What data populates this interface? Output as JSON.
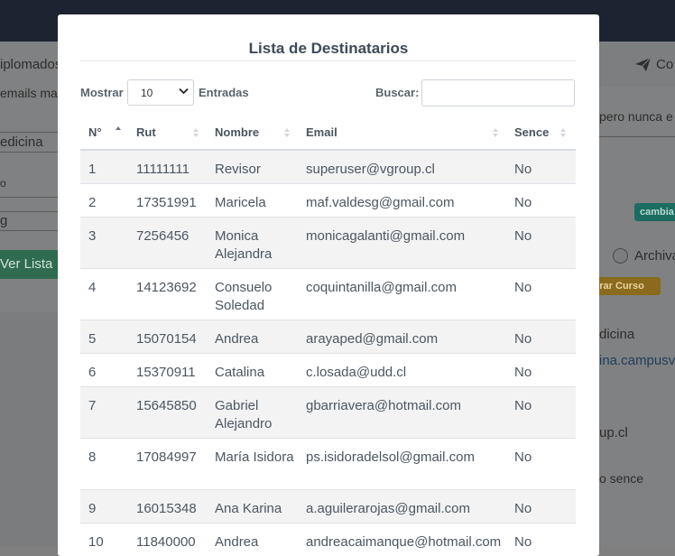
{
  "background": {
    "left_texts": [
      "iplomados",
      "emails ma",
      "edicina",
      "o",
      "g"
    ],
    "ver_lista_button": "Ver Lista",
    "right_texts": {
      "top_button": "Co",
      "note": "pero nunca e",
      "badge_teal": "cambia",
      "radio_label": "Archiva",
      "badge_orange": "rrar Curso",
      "course": "dicina",
      "link": "ina.campusv",
      "email_frag": "up.cl",
      "sence_frag": "o sence"
    }
  },
  "modal": {
    "title": "Lista de Destinatarios",
    "show_label": "Mostrar",
    "entries_select_value": "10",
    "entries_label": "Entradas",
    "search_label": "Buscar:",
    "search_value": "",
    "columns": [
      "N°",
      "Rut",
      "Nombre",
      "Email",
      "Sence"
    ],
    "rows": [
      {
        "n": "1",
        "rut": "11111111",
        "nombre": "Revisor",
        "email": "superuser@vgroup.cl",
        "sence": "No"
      },
      {
        "n": "2",
        "rut": "17351991",
        "nombre": "Maricela",
        "email": "maf.valdesg@gmail.com",
        "sence": "No"
      },
      {
        "n": "3",
        "rut": "7256456",
        "nombre": "Monica Alejandra",
        "email": "monicagalanti@gmail.com",
        "sence": "No"
      },
      {
        "n": "4",
        "rut": "14123692",
        "nombre": "Consuelo Soledad",
        "email": "coquintanilla@gmail.com",
        "sence": "No"
      },
      {
        "n": "5",
        "rut": "15070154",
        "nombre": "Andrea",
        "email": "arayaped@gmail.com",
        "sence": "No"
      },
      {
        "n": "6",
        "rut": "15370911",
        "nombre": "Catalina",
        "email": "c.losada@udd.cl",
        "sence": "No"
      },
      {
        "n": "7",
        "rut": "15645850",
        "nombre": "Gabriel Alejandro",
        "email": "gbarriavera@hotmail.com",
        "sence": "No"
      },
      {
        "n": "8",
        "rut": "17084997",
        "nombre": "María Isidora",
        "email": "ps.isidoradelsol@gmail.com",
        "sence": "No"
      },
      {
        "n": "9",
        "rut": "16015348",
        "nombre": "Ana Karina",
        "email": "a.aguilerarojas@gmail.com",
        "sence": "No"
      },
      {
        "n": "10",
        "rut": "11840000",
        "nombre": "Andrea",
        "email": "andreacaimanque@hotmail.com",
        "sence": "No"
      }
    ]
  }
}
